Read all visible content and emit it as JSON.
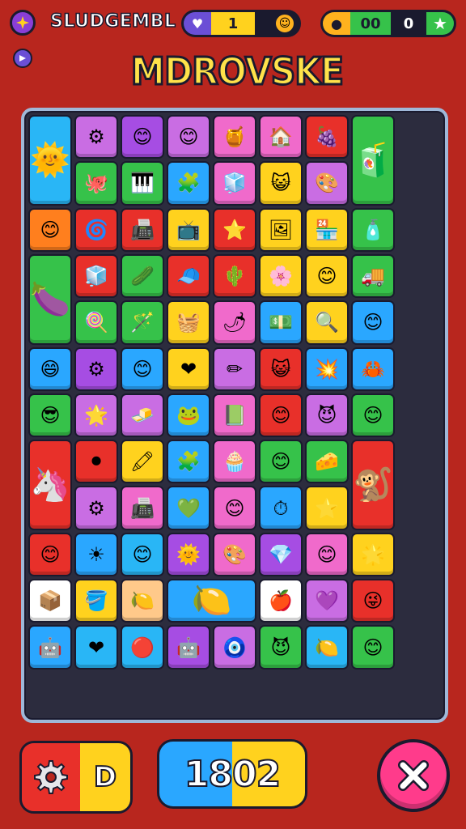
{
  "header": {
    "label": "SLUDGEMBL",
    "gem_count": "1",
    "coin_count": "00",
    "coin_value": "0"
  },
  "title": "MDROVSKE",
  "score": "1802",
  "left_button_text": "D",
  "colors": {
    "background": "#b8261e",
    "board_bg": "#2c2c3e",
    "board_border": "#9fb8d8",
    "close_button": "#ff3b8b"
  },
  "board": {
    "rows": 13,
    "columns": 9,
    "tiles": [
      {
        "col": 1,
        "row": 1,
        "cs": 1,
        "rs": 2,
        "color": "#29b6f6",
        "icon": "🌞"
      },
      {
        "col": 2,
        "row": 1,
        "color": "#c96de3",
        "icon": "⚙"
      },
      {
        "col": 3,
        "row": 1,
        "color": "#a64de3",
        "icon": "😊"
      },
      {
        "col": 4,
        "row": 1,
        "color": "#c96de3",
        "icon": "😊"
      },
      {
        "col": 5,
        "row": 1,
        "color": "#f06acb",
        "icon": "🍯"
      },
      {
        "col": 6,
        "row": 1,
        "color": "#f06acb",
        "icon": "🏠"
      },
      {
        "col": 7,
        "row": 1,
        "color": "#e8302a",
        "icon": "🍇"
      },
      {
        "col": 8,
        "row": 1,
        "cs": 1,
        "rs": 2,
        "color": "#36c24a",
        "icon": "🧃"
      },
      {
        "col": 2,
        "row": 2,
        "color": "#36c24a",
        "icon": "🐙"
      },
      {
        "col": 3,
        "row": 2,
        "color": "#36c24a",
        "icon": "🎹"
      },
      {
        "col": 4,
        "row": 2,
        "color": "#2aa7ff",
        "icon": "🧩"
      },
      {
        "col": 5,
        "row": 2,
        "color": "#f06acb",
        "icon": "🧊"
      },
      {
        "col": 6,
        "row": 2,
        "color": "#ffd21e",
        "icon": "😺"
      },
      {
        "col": 7,
        "row": 2,
        "color": "#c96de3",
        "icon": "🎨"
      },
      {
        "col": 1,
        "row": 3,
        "color": "#ff7f1e",
        "icon": "😊"
      },
      {
        "col": 2,
        "row": 3,
        "color": "#e8302a",
        "icon": "🌀"
      },
      {
        "col": 3,
        "row": 3,
        "color": "#e8302a",
        "icon": "📠"
      },
      {
        "col": 4,
        "row": 3,
        "color": "#ffd21e",
        "icon": "📺"
      },
      {
        "col": 5,
        "row": 3,
        "color": "#e8302a",
        "icon": "⭐"
      },
      {
        "col": 6,
        "row": 3,
        "color": "#ffd21e",
        "icon": "🖼"
      },
      {
        "col": 7,
        "row": 3,
        "color": "#ffd21e",
        "icon": "🏪"
      },
      {
        "col": 8,
        "row": 3,
        "color": "#36c24a",
        "icon": "🧴"
      },
      {
        "col": 1,
        "row": 4,
        "cs": 1,
        "rs": 2,
        "color": "#36c24a",
        "icon": "🍆"
      },
      {
        "col": 2,
        "row": 4,
        "color": "#e8302a",
        "icon": "🧊"
      },
      {
        "col": 3,
        "row": 4,
        "color": "#36c24a",
        "icon": "🥒"
      },
      {
        "col": 4,
        "row": 4,
        "color": "#e8302a",
        "icon": "🧢"
      },
      {
        "col": 5,
        "row": 4,
        "color": "#e8302a",
        "icon": "🌵"
      },
      {
        "col": 6,
        "row": 4,
        "color": "#ffd21e",
        "icon": "🌸"
      },
      {
        "col": 7,
        "row": 4,
        "color": "#ffd21e",
        "icon": "😊"
      },
      {
        "col": 8,
        "row": 4,
        "color": "#36c24a",
        "icon": "🚚"
      },
      {
        "col": 2,
        "row": 5,
        "color": "#36c24a",
        "icon": "🍭"
      },
      {
        "col": 3,
        "row": 5,
        "color": "#36c24a",
        "icon": "🪄"
      },
      {
        "col": 4,
        "row": 5,
        "color": "#ffd21e",
        "icon": "🧺"
      },
      {
        "col": 5,
        "row": 5,
        "color": "#f06acb",
        "icon": "🌶"
      },
      {
        "col": 6,
        "row": 5,
        "color": "#2aa7ff",
        "icon": "💵"
      },
      {
        "col": 7,
        "row": 5,
        "color": "#ffd21e",
        "icon": "🔍"
      },
      {
        "col": 8,
        "row": 5,
        "color": "#2aa7ff",
        "icon": "😊"
      },
      {
        "col": 1,
        "row": 6,
        "color": "#2aa7ff",
        "icon": "😄"
      },
      {
        "col": 2,
        "row": 6,
        "color": "#a64de3",
        "icon": "⚙"
      },
      {
        "col": 3,
        "row": 6,
        "color": "#2aa7ff",
        "icon": "😊"
      },
      {
        "col": 4,
        "row": 6,
        "color": "#ffd21e",
        "icon": "❤"
      },
      {
        "col": 5,
        "row": 6,
        "color": "#c96de3",
        "icon": "✏"
      },
      {
        "col": 6,
        "row": 6,
        "color": "#e8302a",
        "icon": "😺"
      },
      {
        "col": 7,
        "row": 6,
        "color": "#2aa7ff",
        "icon": "💥"
      },
      {
        "col": 8,
        "row": 6,
        "color": "#2aa7ff",
        "icon": "🦀"
      },
      {
        "col": 1,
        "row": 7,
        "color": "#36c24a",
        "icon": "😎"
      },
      {
        "col": 2,
        "row": 7,
        "color": "#c96de3",
        "icon": "🌟"
      },
      {
        "col": 3,
        "row": 7,
        "color": "#c96de3",
        "icon": "🧈"
      },
      {
        "col": 4,
        "row": 7,
        "color": "#2aa7ff",
        "icon": "🐸"
      },
      {
        "col": 5,
        "row": 7,
        "color": "#f06acb",
        "icon": "📗"
      },
      {
        "col": 6,
        "row": 7,
        "color": "#e8302a",
        "icon": "😊"
      },
      {
        "col": 7,
        "row": 7,
        "color": "#c96de3",
        "icon": "😈"
      },
      {
        "col": 8,
        "row": 7,
        "color": "#36c24a",
        "icon": "😊"
      },
      {
        "col": 1,
        "row": 8,
        "cs": 1,
        "rs": 2,
        "color": "#e8302a",
        "icon": "🦄"
      },
      {
        "col": 2,
        "row": 8,
        "color": "#e8302a",
        "icon": "⚫"
      },
      {
        "col": 3,
        "row": 8,
        "color": "#ffd21e",
        "icon": "🖍"
      },
      {
        "col": 4,
        "row": 8,
        "color": "#2aa7ff",
        "icon": "🧩"
      },
      {
        "col": 5,
        "row": 8,
        "color": "#f06acb",
        "icon": "🧁"
      },
      {
        "col": 6,
        "row": 8,
        "color": "#36c24a",
        "icon": "😊"
      },
      {
        "col": 7,
        "row": 8,
        "color": "#36c24a",
        "icon": "🧀"
      },
      {
        "col": 8,
        "row": 8,
        "cs": 1,
        "rs": 2,
        "color": "#e8302a",
        "icon": "🐒"
      },
      {
        "col": 2,
        "row": 9,
        "color": "#c96de3",
        "icon": "⚙"
      },
      {
        "col": 3,
        "row": 9,
        "color": "#f06acb",
        "icon": "📠"
      },
      {
        "col": 4,
        "row": 9,
        "color": "#2aa7ff",
        "icon": "💚"
      },
      {
        "col": 5,
        "row": 9,
        "color": "#f06acb",
        "icon": "😊"
      },
      {
        "col": 6,
        "row": 9,
        "color": "#2aa7ff",
        "icon": "⏱"
      },
      {
        "col": 7,
        "row": 9,
        "color": "#ffd21e",
        "icon": "⭐"
      },
      {
        "col": 1,
        "row": 10,
        "color": "#e8302a",
        "icon": "😊"
      },
      {
        "col": 2,
        "row": 10,
        "color": "#2aa7ff",
        "icon": "☀"
      },
      {
        "col": 3,
        "row": 10,
        "color": "#29b6f6",
        "icon": "😊"
      },
      {
        "col": 4,
        "row": 10,
        "color": "#a64de3",
        "icon": "🌞"
      },
      {
        "col": 5,
        "row": 10,
        "color": "#f06acb",
        "icon": "🎨"
      },
      {
        "col": 6,
        "row": 10,
        "color": "#a64de3",
        "icon": "💎"
      },
      {
        "col": 7,
        "row": 10,
        "color": "#f06acb",
        "icon": "😊"
      },
      {
        "col": 8,
        "row": 10,
        "color": "#ffd21e",
        "icon": "🌟"
      },
      {
        "col": 1,
        "row": 11,
        "color": "#ffffff",
        "icon": "📦"
      },
      {
        "col": 2,
        "row": 11,
        "color": "#ffd21e",
        "icon": "🪣"
      },
      {
        "col": 3,
        "row": 11,
        "color": "#ffc98a",
        "icon": "🍋"
      },
      {
        "col": 4,
        "row": 11,
        "cs": 2,
        "rs": 1,
        "color": "#2aa7ff",
        "icon": "🍋"
      },
      {
        "col": 6,
        "row": 11,
        "color": "#ffffff",
        "icon": "🍎"
      },
      {
        "col": 7,
        "row": 11,
        "color": "#c96de3",
        "icon": "💜"
      },
      {
        "col": 8,
        "row": 11,
        "color": "#e8302a",
        "icon": "😜"
      },
      {
        "col": 1,
        "row": 12,
        "color": "#2aa7ff",
        "icon": "🤖"
      },
      {
        "col": 2,
        "row": 12,
        "color": "#29b6f6",
        "icon": "❤"
      },
      {
        "col": 3,
        "row": 12,
        "color": "#29b6f6",
        "icon": "🔴"
      },
      {
        "col": 4,
        "row": 12,
        "color": "#a64de3",
        "icon": "🤖"
      },
      {
        "col": 5,
        "row": 12,
        "color": "#c96de3",
        "icon": "🧿"
      },
      {
        "col": 6,
        "row": 12,
        "color": "#36c24a",
        "icon": "😈"
      },
      {
        "col": 7,
        "row": 12,
        "color": "#29b6f6",
        "icon": "🍋"
      },
      {
        "col": 8,
        "row": 12,
        "color": "#36c24a",
        "icon": "😊"
      },
      {
        "col": 1,
        "row": 13,
        "color": "#2c2c3e",
        "icon": ""
      },
      {
        "col": 9,
        "row": 1,
        "cs": 1,
        "rs": 13,
        "color": "#2c2c3e",
        "icon": ""
      }
    ]
  }
}
